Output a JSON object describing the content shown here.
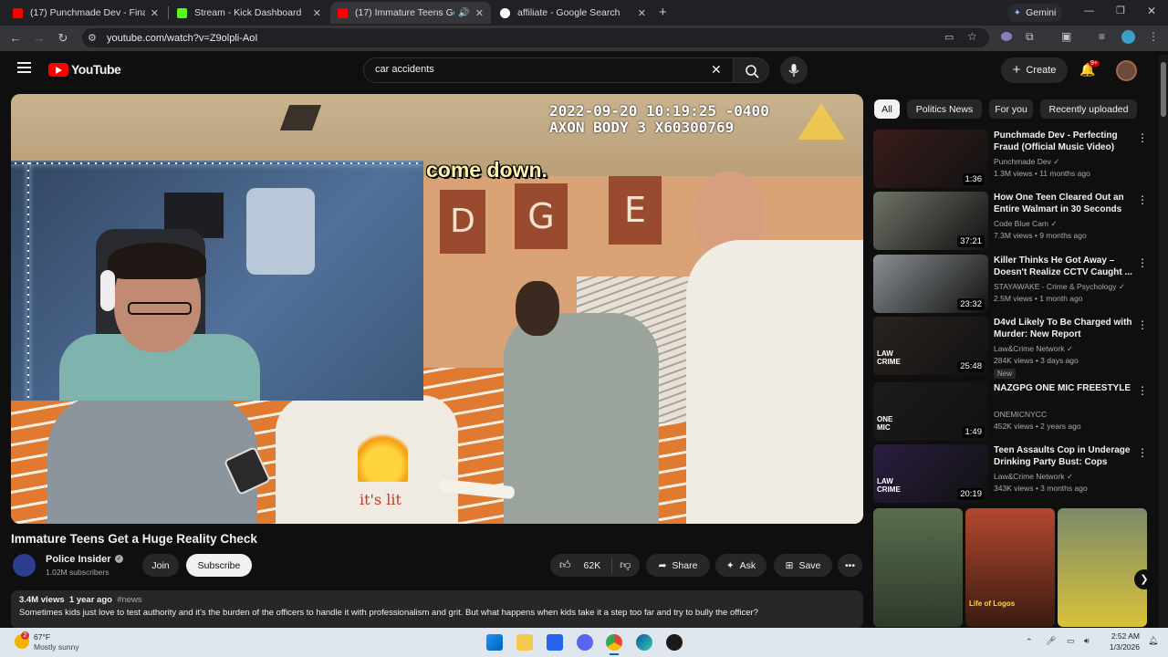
{
  "browser": {
    "tabs": [
      {
        "title": "(17) Punchmade Dev - Financia",
        "favicon": "youtube-icon"
      },
      {
        "title": "Stream - Kick Dashboard",
        "favicon": "kick-icon"
      },
      {
        "title": "(17) Immature Teens Get a H",
        "favicon": "youtube-icon",
        "active": true
      },
      {
        "title": "affiliate - Google Search",
        "favicon": "google-icon"
      }
    ],
    "gemini_label": "Gemini",
    "url": "youtube.com/watch?v=Z9olpli-AoI"
  },
  "youtube": {
    "logo_text": "YouTube",
    "search_value": "car accidents",
    "create_label": "Create",
    "notif_count": "9+"
  },
  "video": {
    "timestamp_line1": "2022-09-20 10:19:25 -0400",
    "timestamp_line2": "AXON BODY 3 X60300769",
    "caption": "come down.",
    "letters": [
      "D",
      "G",
      "E"
    ],
    "shirt_text": "it's lit",
    "title": "Immature Teens Get a Huge Reality Check",
    "channel": "Police Insider",
    "subscribers": "1.02M subscribers",
    "join_label": "Join",
    "subscribe_label": "Subscribe",
    "likes": "62K",
    "share_label": "Share",
    "ask_label": "Ask",
    "save_label": "Save",
    "views": "3.4M views",
    "age": "1 year ago",
    "hashtag": "#news",
    "description": "Sometimes kids just love to test authority and it's the burden of the officers to handle it with professionalism and grit. But what happens when kids take it a step too far and try to bully the officer?"
  },
  "chips": [
    "All",
    "Politics News",
    "For you",
    "Recently uploaded"
  ],
  "recommendations": [
    {
      "title": "Punchmade Dev - Perfecting Fraud (Official Music Video)",
      "channel": "Punchmade Dev",
      "meta": "1.3M views • 11 months ago",
      "duration": "1:36",
      "verified": true,
      "thumb_color": "#3a1c1c"
    },
    {
      "title": "How One Teen Cleared Out an Entire Walmart in 30 Seconds",
      "channel": "Code Blue Cam",
      "meta": "7.3M views • 9 months ago",
      "duration": "37:21",
      "verified": true,
      "thumb_color": "#6f7468"
    },
    {
      "title": "Killer Thinks He Got Away – Doesn't Realize CCTV Caught ...",
      "channel": "STAYAWAKE - Crime & Psychology",
      "meta": "2.5M views • 1 month ago",
      "duration": "23:32",
      "verified": true,
      "thumb_color": "#8a8f93"
    },
    {
      "title": "D4vd Likely To Be Charged with Murder: New Report",
      "channel": "Law&Crime Network",
      "meta": "284K views • 3 days ago",
      "duration": "25:48",
      "verified": true,
      "badge": "New",
      "thumb_color": "#2a2320",
      "brand": "LAW CRIME"
    },
    {
      "title": "NAZGPG ONE MIC FREESTYLE",
      "channel": "ONEMICNYCC",
      "meta": "452K views • 2 years ago",
      "duration": "1:49",
      "verified": false,
      "thumb_color": "#1b1b1b",
      "brand": "ONE MIC"
    },
    {
      "title": "Teen Assaults Cop in Underage Drinking Party Bust: Cops",
      "channel": "Law&Crime Network",
      "meta": "343K views • 3 months ago",
      "duration": "20:19",
      "verified": true,
      "thumb_color": "#2a1d40",
      "brand": "LAW CRIME"
    }
  ],
  "shorts_thumb_text": "Life of Logos",
  "taskbar": {
    "temp": "67°F",
    "weather": "Mostly sunny",
    "weather_badge": "2",
    "time": "2:52 AM",
    "date": "1/3/2026"
  }
}
